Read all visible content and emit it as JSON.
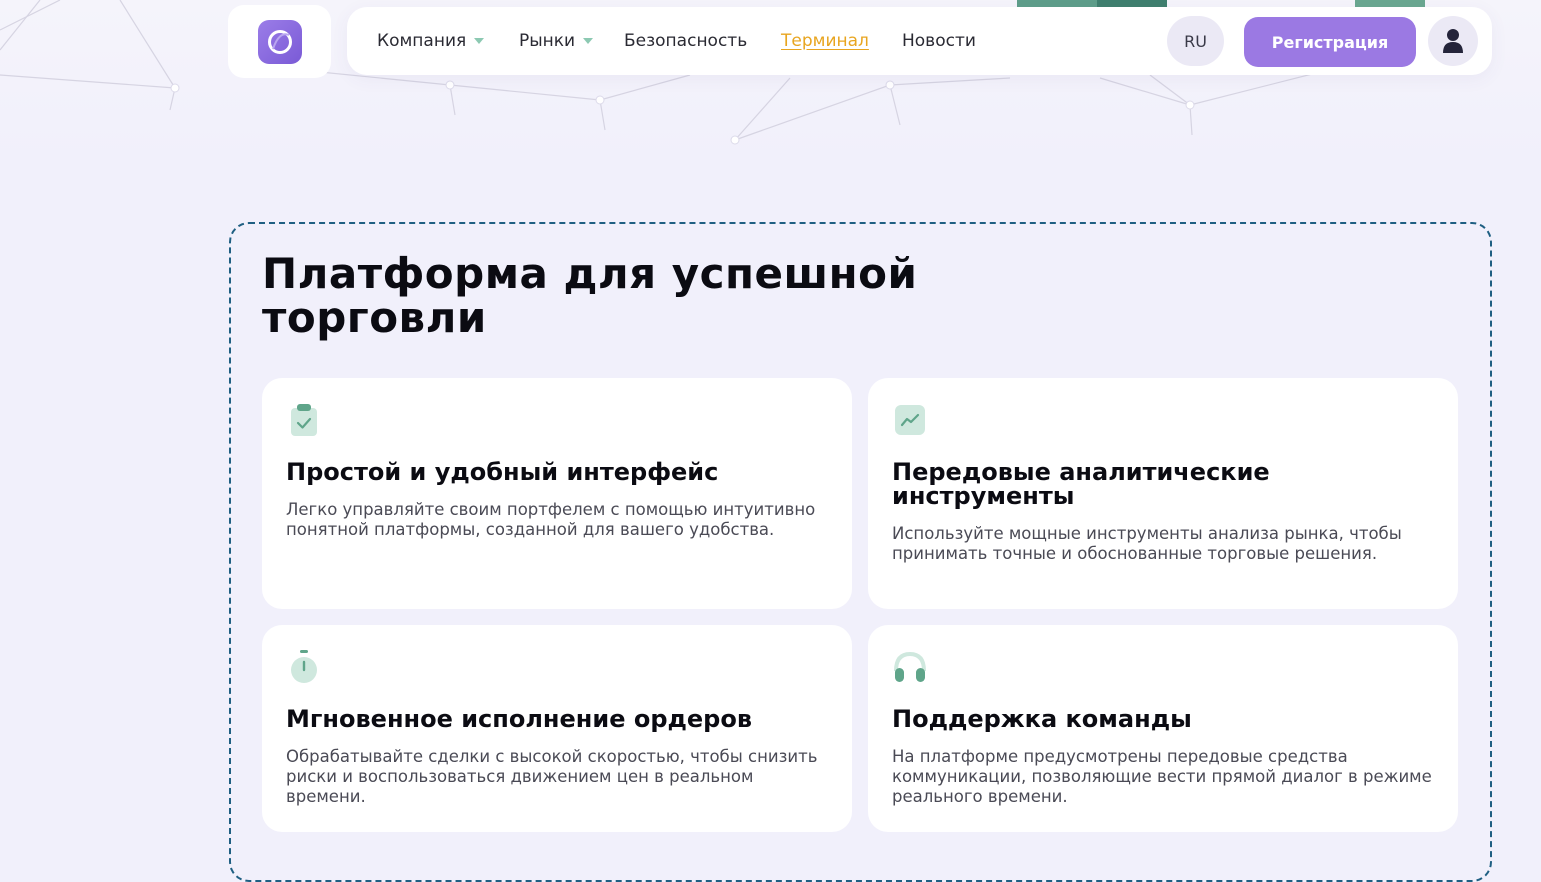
{
  "header": {
    "nav": [
      {
        "label": "Компания",
        "has_dropdown": true
      },
      {
        "label": "Рынки",
        "has_dropdown": true
      },
      {
        "label": "Безопасность",
        "has_dropdown": false
      },
      {
        "label": "Терминал",
        "has_dropdown": false,
        "active": true
      },
      {
        "label": "Новости",
        "has_dropdown": false
      }
    ],
    "language": "RU",
    "register_label": "Регистрация",
    "logo_icon": "ring-logo-icon",
    "user_icon": "user-icon"
  },
  "section": {
    "title": "Платформа для успешной торговли",
    "cards": [
      {
        "icon": "clipboard-check-icon",
        "title": "Простой и удобный интерфейс",
        "text": "Легко управляйте своим портфелем с помощью интуитивно понятной платформы, созданной для вашего удобства."
      },
      {
        "icon": "chart-line-icon",
        "title": "Передовые аналитические инструменты",
        "text": "Используйте мощные инструменты анализа рынка, чтобы принимать точные и обоснованные торговые решения."
      },
      {
        "icon": "stopwatch-icon",
        "title": "Мгновенное исполнение ордеров",
        "text": "Обрабатывайте сделки с высокой скоростью, чтобы снизить риски и воспользоваться движением цен в реальном времени."
      },
      {
        "icon": "headphones-icon",
        "title": "Поддержка команды",
        "text": "На платформе предусмотрены передовые средства коммуникации, позволяющие вести прямой диалог в режиме реального времени."
      }
    ]
  },
  "colors": {
    "accent": "#9b79e3",
    "active_link": "#e8a520",
    "icon_green": "#5fa58a",
    "icon_bg": "#cfe8de",
    "panel_border": "#1f5f82",
    "background": "#f1f0fb"
  }
}
